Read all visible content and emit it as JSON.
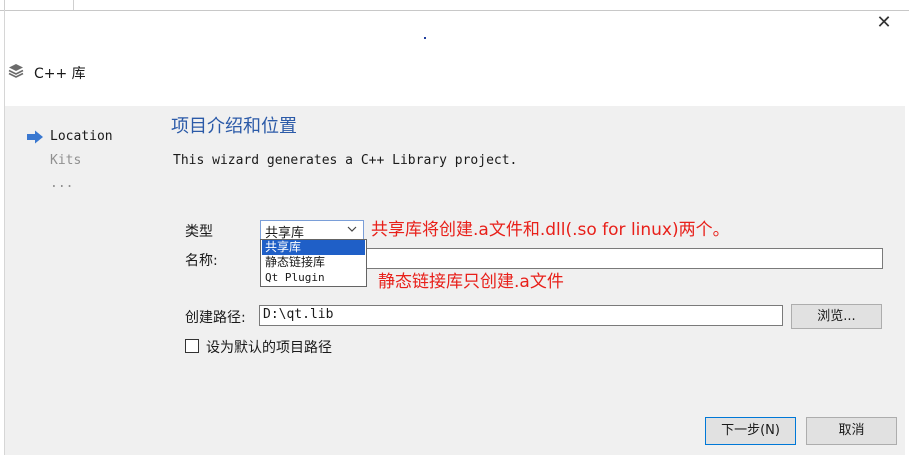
{
  "window": {
    "title": "C++ 库",
    "close_glyph": "✕"
  },
  "nav": {
    "items": [
      {
        "label": "Location",
        "active": true
      },
      {
        "label": "Kits",
        "active": false
      },
      {
        "label": "...",
        "active": false
      }
    ]
  },
  "page": {
    "title": "项目介绍和位置",
    "description": "This wizard generates a C++ Library project."
  },
  "form": {
    "type_label": "类型",
    "type_selected": "共享库",
    "type_options": [
      "共享库",
      "静态链接库",
      "Qt Plugin"
    ],
    "name_label": "名称:",
    "name_value": "",
    "path_label": "创建路径:",
    "path_value": "D:\\qt.lib",
    "browse_label": "浏览...",
    "default_path_label": "设为默认的项目路径",
    "default_path_checked": false
  },
  "buttons": {
    "next": "下一步(N)",
    "cancel": "取消"
  },
  "annotations": {
    "shared": "共享库将创建.a文件和.dll(.so for linux)两个。",
    "static": "静态链接库只创建.a文件"
  },
  "colors": {
    "accent_title": "#2b5aa8",
    "selection": "#1f5fc7",
    "annotation": "#e8201a"
  },
  "icons": {
    "app_icon": "library-stack-icon",
    "nav_arrow": "arrow-right-icon",
    "combo_chevron": "chevron-down-icon",
    "close": "close-icon"
  }
}
